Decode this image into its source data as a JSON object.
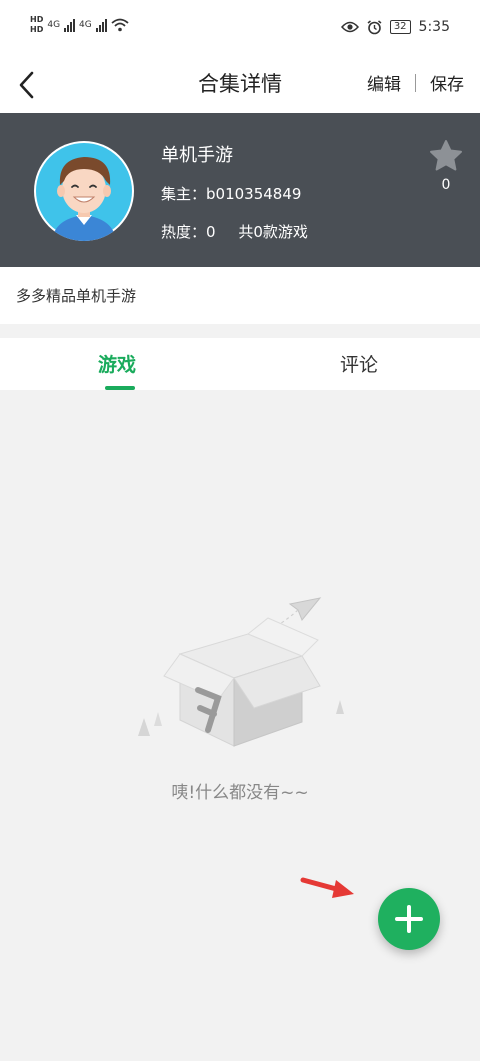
{
  "status_bar": {
    "left_icons": [
      "hd-icon",
      "signal-icon",
      "signal-icon",
      "wifi-icon"
    ],
    "network_label_1": "4G",
    "network_label_2": "4G",
    "hd_label_1": "HD",
    "hd_label_2": "HD",
    "right_icons": [
      "eye-icon",
      "alarm-icon"
    ],
    "battery": "32",
    "time": "5:35"
  },
  "navbar": {
    "back_icon": "chevron-left-icon",
    "title": "合集详情",
    "edit_label": "编辑",
    "save_label": "保存"
  },
  "collection": {
    "name": "单机手游",
    "owner": "集主：b010354849",
    "heat": "热度：0",
    "game_count": "共0款游戏",
    "favorite_icon": "star-icon",
    "favorite_count": "0",
    "description": "多多精品单机手游"
  },
  "tabs": {
    "games": "游戏",
    "comments": "评论",
    "active": "games"
  },
  "empty_state": {
    "illustration": "empty-box-icon",
    "text": "咦!什么都没有~~"
  },
  "fab": {
    "icon": "plus-icon"
  },
  "colors": {
    "accent": "#1aab5c",
    "header_bg": "#4a4f55",
    "annotation_arrow": "#e53935"
  }
}
